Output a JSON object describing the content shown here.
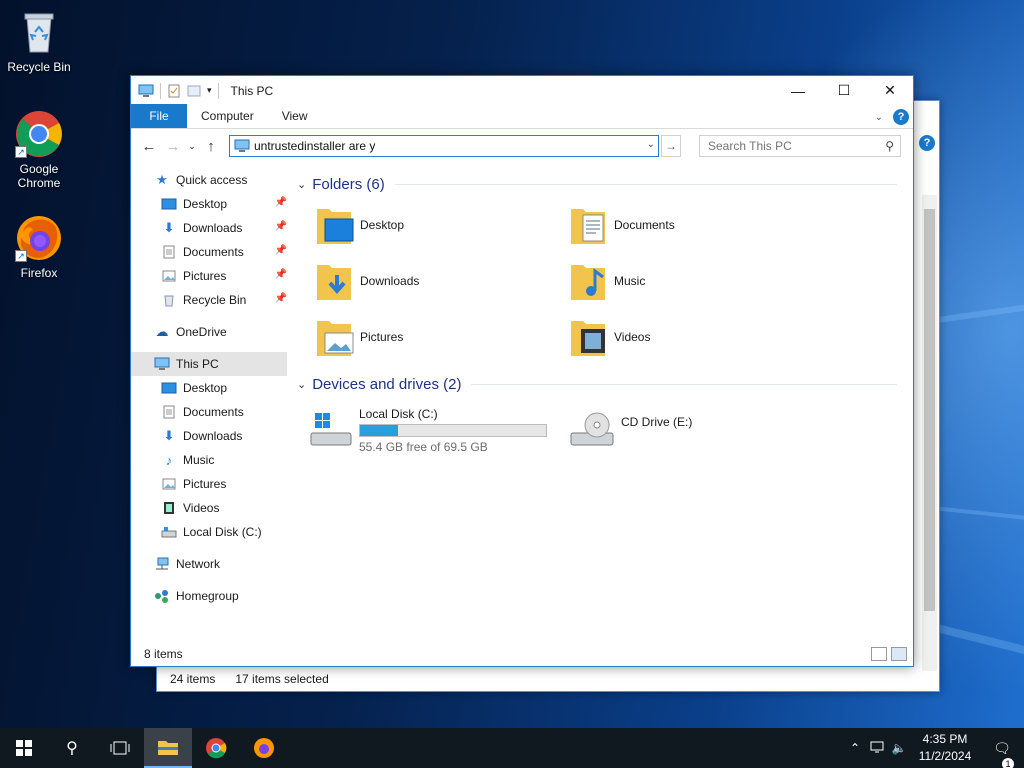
{
  "desktop": {
    "icons": [
      {
        "label": "Recycle Bin"
      },
      {
        "label": "Google\nChrome"
      },
      {
        "label": "Firefox"
      }
    ]
  },
  "back_window": {
    "status_items": "24 items",
    "status_selected": "17 items selected"
  },
  "window": {
    "title": "This PC",
    "ribbon_tabs": [
      "File",
      "Computer",
      "View"
    ],
    "address_value": "untrustedinstaller are y",
    "search_placeholder": "Search This PC",
    "status": "8 items"
  },
  "nav": {
    "quick_access": "Quick access",
    "quick_items": [
      "Desktop",
      "Downloads",
      "Documents",
      "Pictures",
      "Recycle Bin"
    ],
    "onedrive": "OneDrive",
    "this_pc": "This PC",
    "pc_items": [
      "Desktop",
      "Documents",
      "Downloads",
      "Music",
      "Pictures",
      "Videos",
      "Local Disk (C:)"
    ],
    "network": "Network",
    "homegroup": "Homegroup"
  },
  "content": {
    "folders_header": "Folders (6)",
    "folders": [
      "Desktop",
      "Documents",
      "Downloads",
      "Music",
      "Pictures",
      "Videos"
    ],
    "devices_header": "Devices and drives (2)",
    "drives": [
      {
        "name": "Local Disk (C:)",
        "free": "55.4 GB free of 69.5 GB",
        "used_fraction": 0.203
      },
      {
        "name": "CD Drive (E:)"
      }
    ]
  },
  "taskbar": {
    "time": "4:35 PM",
    "date": "11/2/2024",
    "notifications": "1"
  },
  "colors": {
    "accent": "#1979ca",
    "folder_yellow": "#f2c44b",
    "header_blue": "#1e3287"
  }
}
